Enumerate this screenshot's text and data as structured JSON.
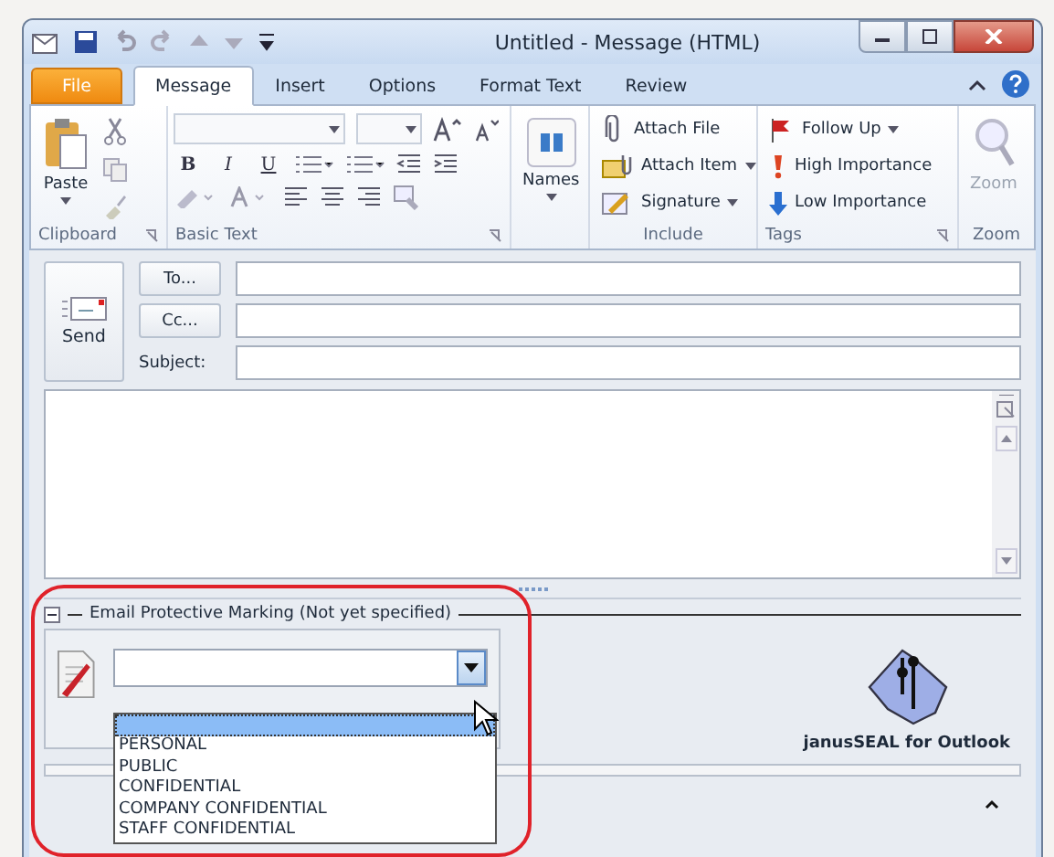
{
  "window": {
    "title": "Untitled  -  Message (HTML)"
  },
  "tabs": [
    {
      "label": "File",
      "kind": "file",
      "selected": false
    },
    {
      "label": "Message",
      "kind": "tab",
      "selected": true
    },
    {
      "label": "Insert",
      "kind": "tab",
      "selected": false
    },
    {
      "label": "Options",
      "kind": "tab",
      "selected": false
    },
    {
      "label": "Format Text",
      "kind": "tab",
      "selected": false
    },
    {
      "label": "Review",
      "kind": "tab",
      "selected": false
    }
  ],
  "ribbon": {
    "clipboard": {
      "paste": "Paste",
      "label": "Clipboard"
    },
    "basic_text": {
      "bold": "B",
      "italic": "I",
      "underline": "U",
      "label": "Basic Text"
    },
    "names": {
      "button": "Names"
    },
    "include": {
      "items": [
        {
          "label": "Attach File",
          "kind": "attach"
        },
        {
          "label": "Attach Item",
          "kind": "item"
        },
        {
          "label": "Signature",
          "kind": "signature"
        }
      ],
      "label": "Include"
    },
    "tags": {
      "items": [
        {
          "label": "Follow Up",
          "kind": "flag"
        },
        {
          "label": "High Importance",
          "kind": "high"
        },
        {
          "label": "Low Importance",
          "kind": "low"
        }
      ],
      "label": "Tags"
    },
    "zoom": {
      "button": "Zoom",
      "label": "Zoom",
      "disabled": true
    }
  },
  "compose": {
    "send": "Send",
    "to": "To...",
    "cc": "Cc...",
    "subject": "Subject:"
  },
  "marking": {
    "title": "Email Protective Marking (Not yet specified)",
    "dropdown": {
      "open": true,
      "blank_selected": true,
      "options": [
        {
          "label": "PERSONAL",
          "selected": false
        },
        {
          "label": "PUBLIC",
          "selected": false
        },
        {
          "label": "CONFIDENTIAL",
          "selected": false
        },
        {
          "label": "COMPANY CONFIDENTIAL",
          "selected": false
        },
        {
          "label": "STAFF CONFIDENTIAL",
          "selected": false
        }
      ]
    },
    "brand": "janusSEAL for Outlook"
  }
}
